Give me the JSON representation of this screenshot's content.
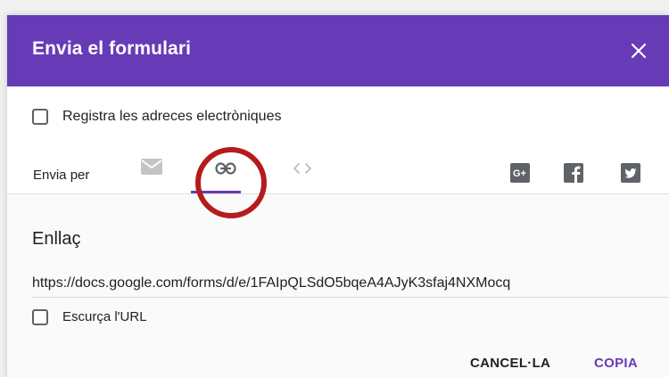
{
  "dialog": {
    "title": "Envia el formulari",
    "close_icon": "close-icon"
  },
  "collect_emails": {
    "label": "Registra les adreces electròniques",
    "checked": false
  },
  "send_via": {
    "label": "Envia per",
    "tabs": [
      {
        "icon": "email-icon",
        "selected": false
      },
      {
        "icon": "link-icon",
        "selected": true
      },
      {
        "icon": "embed-icon",
        "selected": false
      }
    ],
    "social": [
      {
        "icon": "google-plus-icon"
      },
      {
        "icon": "facebook-icon"
      },
      {
        "icon": "twitter-icon"
      }
    ]
  },
  "link_section": {
    "title": "Enllaç",
    "url": "https://docs.google.com/forms/d/e/1FAIpQLSdO5bqeA4AJyK3sfaj4NXMocq",
    "shorten_label": "Escurça l'URL",
    "shorten_checked": false
  },
  "actions": {
    "cancel": "CANCEL·LA",
    "copy": "COPIA"
  },
  "colors": {
    "header": "#673ab7",
    "accent": "#673ab7",
    "annotation": "#b51b1b"
  }
}
